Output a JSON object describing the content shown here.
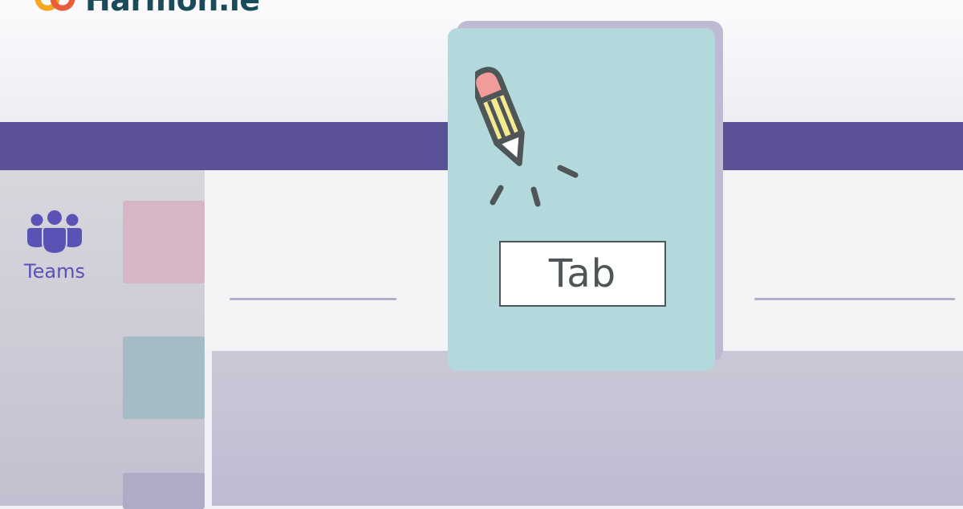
{
  "logo": {
    "text": "Harmon.ie",
    "icon": "harmonie-logo-icon"
  },
  "sidebar": {
    "teams_label": "Teams",
    "teams_icon": "teams-people-icon"
  },
  "card": {
    "tab_label": "Tab",
    "icon": "pencil-icon"
  },
  "colors": {
    "brand_bar": "#5b5196",
    "teams_accent": "#5a52b5",
    "card_background": "#b3d9dc",
    "pencil_eraser": "#f29b9b",
    "pencil_body": "#f7e98f",
    "outline": "#4f5658"
  }
}
